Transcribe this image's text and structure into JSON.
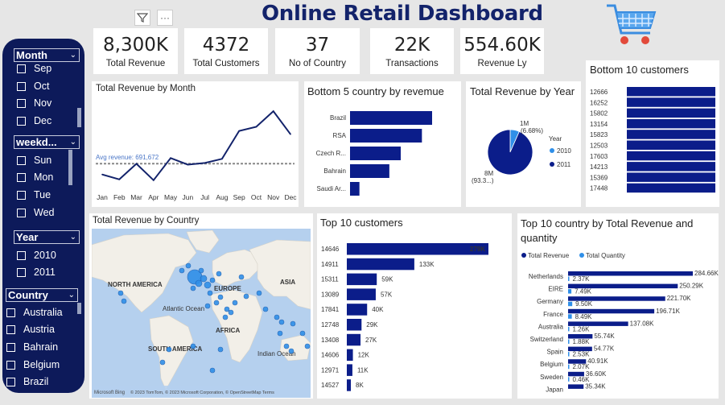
{
  "header": {
    "title": "Online Retail Dashboard"
  },
  "toolbar": {
    "filter_icon": "filter-icon",
    "more_label": "···"
  },
  "colors": {
    "navy": "#13236b",
    "dark": "#0d1a5a",
    "bar": "#0b1d8a",
    "light": "#2f8fe8",
    "avg": "#4a76c7"
  },
  "kpis": [
    {
      "value": "8,300K",
      "label": "Total Revenue"
    },
    {
      "value": "4372",
      "label": "Total Customers"
    },
    {
      "value": "37",
      "label": "No of Country"
    },
    {
      "value": "22K",
      "label": "Transactions"
    },
    {
      "value": "554.60K",
      "label": "Revenue Ly"
    }
  ],
  "slicers": {
    "month": {
      "label": "Month",
      "items": [
        "Sep",
        "Oct",
        "Nov",
        "Dec"
      ]
    },
    "weekday": {
      "label": "weekd...",
      "items": [
        "Sun",
        "Mon",
        "Tue",
        "Wed"
      ]
    },
    "year": {
      "label": "Year",
      "items": [
        "2010",
        "2011"
      ]
    },
    "country": {
      "label": "Country",
      "items": [
        "Australia",
        "Austria",
        "Bahrain",
        "Belgium",
        "Brazil"
      ]
    }
  },
  "chart_data": [
    {
      "id": "revenue_by_month",
      "type": "line",
      "title": "Total Revenue by Month",
      "categories": [
        "Jan",
        "Feb",
        "Mar",
        "Apr",
        "May",
        "Jun",
        "Jul",
        "Aug",
        "Sep",
        "Oct",
        "Nov",
        "Dec"
      ],
      "values": [
        560,
        500,
        690,
        490,
        760,
        680,
        700,
        750,
        1090,
        1140,
        1330,
        1050
      ],
      "reference_line": {
        "label": "Avg revenue: 691,672",
        "value": 691672
      },
      "ylim": [
        400,
        1400
      ]
    },
    {
      "id": "bottom5_country",
      "type": "bar",
      "title": "Bottom 5 country by revemue",
      "categories": [
        "Brazil",
        "RSA",
        "Czech R...",
        "Bahrain",
        "Saudi Ar..."
      ],
      "values": [
        1144,
        1002,
        707,
        548,
        131
      ]
    },
    {
      "id": "revenue_by_year",
      "type": "pie",
      "title": "Total Revenue by Year",
      "legend_title": "Year",
      "series": [
        {
          "name": "2010",
          "value": 0.55,
          "label": "1M",
          "pct": "(6.68%)"
        },
        {
          "name": "2011",
          "value": 7.75,
          "label": "8M",
          "pct": "(93.3...)"
        }
      ]
    },
    {
      "id": "bottom10_customers",
      "type": "bar",
      "title": "Bottom 10 customers",
      "categories": [
        "12666",
        "16252",
        "15802",
        "13154",
        "15823",
        "12503",
        "17603",
        "14213",
        "15369",
        "17448"
      ],
      "values": [
        1,
        1,
        1,
        1,
        1,
        1,
        1,
        1,
        1,
        1
      ]
    },
    {
      "id": "revenue_by_country",
      "type": "map",
      "title": "Total Revenue by Country",
      "labels": [
        "NORTH AMERICA",
        "EUROPE",
        "ASIA",
        "AFRICA",
        "SOUTH AMERICA",
        "Atlantic Ocean",
        "Indian Ocean"
      ],
      "credit": "© 2023 TomTom, © 2023 Microsoft Corporation, © OpenStreetMap Terms",
      "brand": "Microsoft Bing"
    },
    {
      "id": "top10_customers",
      "type": "bar",
      "title": "Top 10 customers",
      "categories": [
        "14646",
        "14911",
        "15311",
        "13089",
        "17841",
        "12748",
        "13408",
        "14606",
        "12971",
        "14527"
      ],
      "values": [
        279,
        133,
        59,
        57,
        40,
        29,
        27,
        12,
        11,
        8
      ],
      "labels": [
        "279K",
        "133K",
        "59K",
        "57K",
        "40K",
        "29K",
        "27K",
        "12K",
        "11K",
        "8K"
      ]
    },
    {
      "id": "top10_country",
      "type": "bar",
      "title": "Top 10 country by Total Revenue and quantity",
      "categories": [
        "Netherlands",
        "EIRE",
        "Germany",
        "France",
        "Australia",
        "Switzerland",
        "Spain",
        "Belgium",
        "Sweden",
        "Japan"
      ],
      "series": [
        {
          "name": "Total Revenue",
          "values": [
            284.66,
            250.29,
            221.7,
            196.71,
            137.08,
            55.74,
            54.77,
            40.91,
            36.6,
            35.34
          ],
          "labels": [
            "284.66K",
            "250.29K",
            "221.70K",
            "196.71K",
            "137.08K",
            "55.74K",
            "54.77K",
            "40.91K",
            "36.60K",
            "35.34K"
          ]
        },
        {
          "name": "Total Quantity",
          "values": [
            2.37,
            7.49,
            9.5,
            8.49,
            1.26,
            1.88,
            2.53,
            2.07,
            0.46,
            null
          ],
          "labels": [
            "2.37K",
            "7.49K",
            "9.50K",
            "8.49K",
            "1.26K",
            "1.88K",
            "2.53K",
            "2.07K",
            "0.46K",
            ""
          ]
        }
      ]
    }
  ]
}
